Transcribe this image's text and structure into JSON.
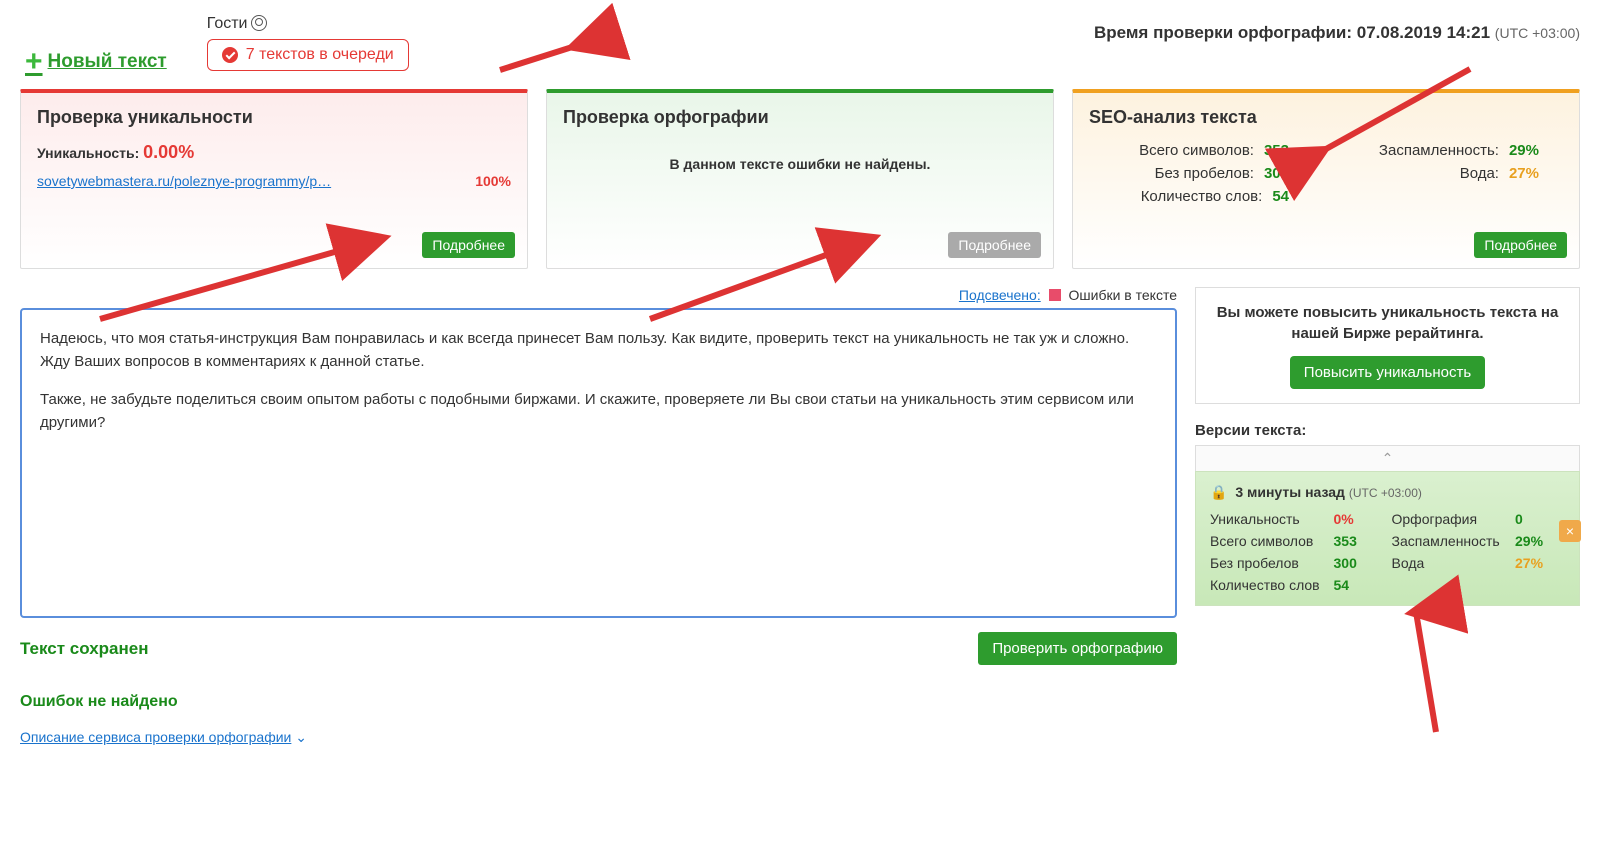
{
  "topbar": {
    "new_text_label": "Новый текст",
    "guests_label": "Гости",
    "queue_label": "7 текстов в очереди",
    "timestamp_prefix": "Время проверки орфографии:",
    "timestamp_value": "07.08.2019 14:21",
    "timestamp_tz": "(UTC +03:00)"
  },
  "panels": {
    "uniqueness": {
      "title": "Проверка уникальности",
      "label": "Уникальность:",
      "value": "0.00%",
      "source_url": "sovetywebmastera.ru/poleznye-programmy/p…",
      "source_pct": "100%",
      "more_btn": "Подробнее"
    },
    "spelling": {
      "title": "Проверка орфографии",
      "message": "В данном тексте ошибки не найдены.",
      "more_btn": "Подробнее"
    },
    "seo": {
      "title": "SEO-анализ текста",
      "chars_label": "Всего символов:",
      "chars_value": "353",
      "nospace_label": "Без пробелов:",
      "nospace_value": "300",
      "words_label": "Количество слов:",
      "words_value": "54",
      "spam_label": "Заспамленность:",
      "spam_value": "29%",
      "water_label": "Вода:",
      "water_value": "27%",
      "more_btn": "Подробнее"
    }
  },
  "editor": {
    "highlight_label": "Подсвечено:",
    "highlight_legend": "Ошибки в тексте",
    "paragraph1": "Надеюсь, что моя статья-инструкция Вам понравилась и как всегда принесет Вам пользу. Как видите, проверить текст на уникальность не так уж и сложно. Жду Ваших вопросов в комментариях к данной статье.",
    "paragraph2": "Также, не забудьте поделиться своим опытом работы с подобными биржами. И скажите, проверяете ли Вы свои статьи на уникальность этим сервисом или другими?",
    "saved_label": "Текст сохранен",
    "check_spell_btn": "Проверить орфографию",
    "no_errors_label": "Ошибок не найдено",
    "desc_link": "Описание сервиса проверки орфографии"
  },
  "right": {
    "promo_text": "Вы можете повысить уникальность текста на нашей Бирже рерайтинга.",
    "promo_btn": "Повысить уникальность",
    "versions_title": "Версии текста:",
    "version": {
      "time": "3 минуты назад",
      "tz": "(UTC +03:00)",
      "uniq_label": "Уникальность",
      "uniq_value": "0%",
      "spell_label": "Орфография",
      "spell_value": "0",
      "chars_label": "Всего символов",
      "chars_value": "353",
      "spam_label": "Заспамленность",
      "spam_value": "29%",
      "nospace_label": "Без пробелов",
      "nospace_value": "300",
      "water_label": "Вода",
      "water_value": "27%",
      "words_label": "Количество слов",
      "words_value": "54"
    }
  }
}
